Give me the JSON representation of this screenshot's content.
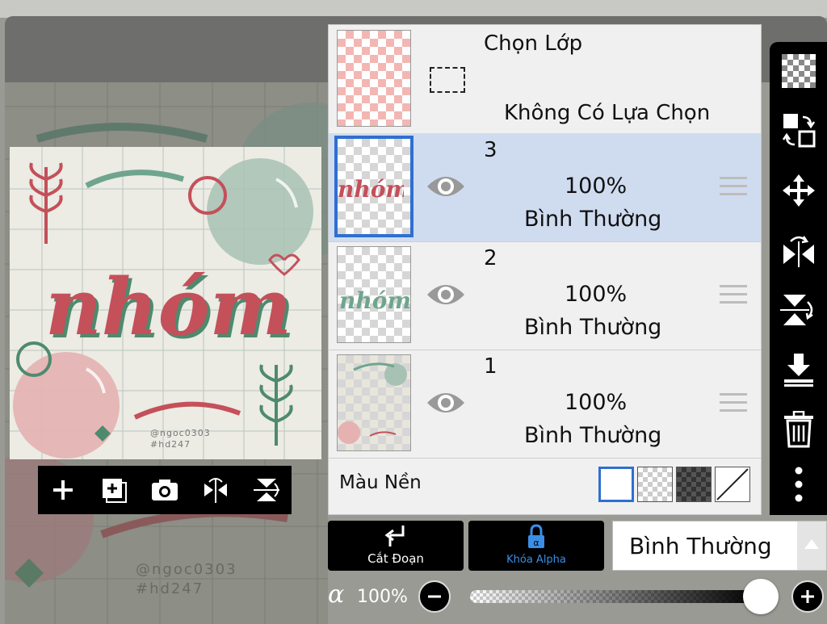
{
  "selection_layer": {
    "title": "Chọn Lớp",
    "subtitle": "Không Có Lựa Chọn"
  },
  "layers": [
    {
      "number": "3",
      "opacity": "100%",
      "blend": "Bình Thường",
      "active": true
    },
    {
      "number": "2",
      "opacity": "100%",
      "blend": "Bình Thường",
      "active": false
    },
    {
      "number": "1",
      "opacity": "100%",
      "blend": "Bình Thường",
      "active": false
    }
  ],
  "background": {
    "label": "Màu Nền",
    "swatches": [
      "white",
      "transparent",
      "dark-checker",
      "none"
    ],
    "selected": "white"
  },
  "canvas": {
    "artwork_text": "nhóm",
    "watermark_line1": "@ngoc0303",
    "watermark_line2": "#hd247"
  },
  "bottom_bar": {
    "clip_label": "Cắt Đoạn",
    "alpha_lock_label": "Khóa Alpha",
    "blend_mode": "Bình Thường",
    "alpha_symbol": "α",
    "opacity": "100%",
    "opacity_value": 1.0
  },
  "colors": {
    "accent_blue": "#2f6fd0",
    "active_row": "#cfdcf0",
    "alpha_lock_blue": "#3a8ee6",
    "artwork_red": "#c4505a",
    "artwork_green": "#4e8a6e"
  }
}
